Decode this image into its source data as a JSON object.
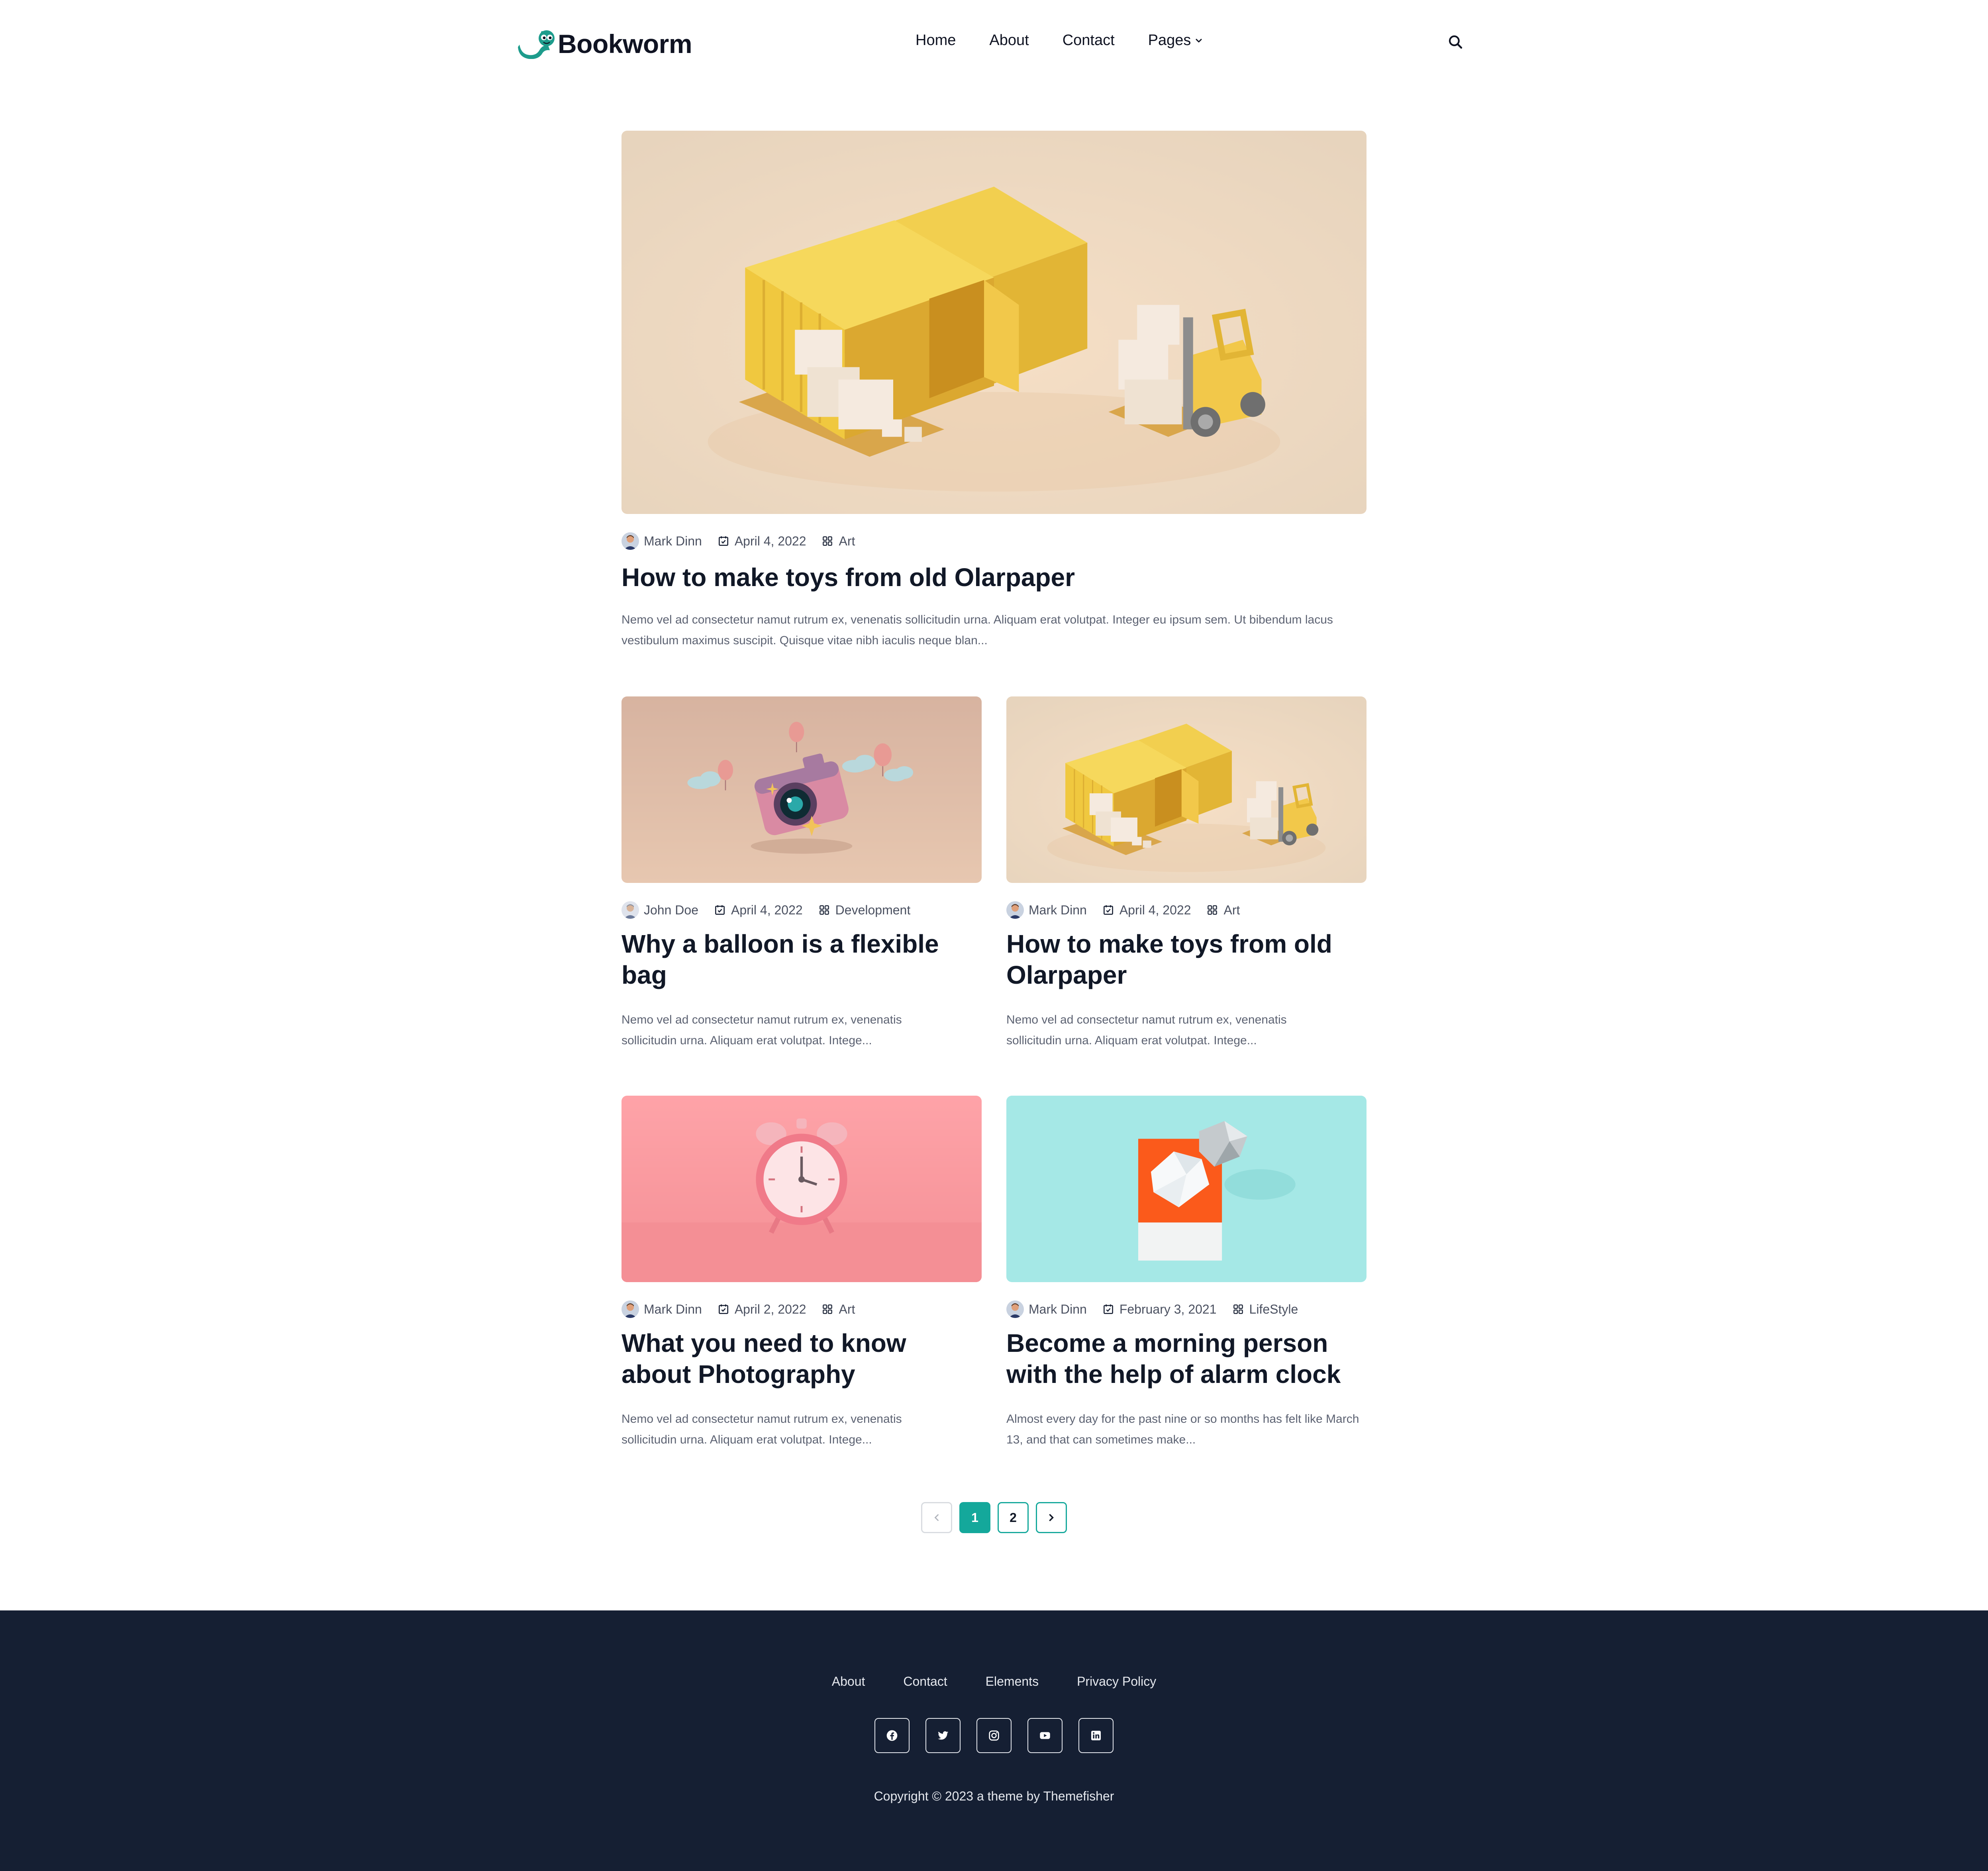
{
  "header": {
    "brand": "Bookworm",
    "nav": [
      {
        "label": "Home"
      },
      {
        "label": "About"
      },
      {
        "label": "Contact"
      },
      {
        "label": "Pages"
      }
    ],
    "accent_color": "#14a89b"
  },
  "posts": [
    {
      "author": "Mark Dinn",
      "date": "April 4, 2022",
      "category": "Art",
      "title": "How to make toys from old Olarpaper",
      "excerpt": "Nemo vel ad consectetur namut rutrum ex, venenatis sollicitudin urna. Aliquam erat volutpat. Integer eu ipsum sem. Ut bibendum lacus vestibulum maximus suscipit. Quisque vitae nibh iaculis neque blan...",
      "image": "yellow-containers-forklift"
    },
    {
      "author": "John Doe",
      "date": "April 4, 2022",
      "category": "Development",
      "title": "Why a balloon is a flexible bag",
      "excerpt": "Nemo vel ad consectetur namut rutrum ex, venenatis sollicitudin urna. Aliquam erat volutpat. Intege...",
      "image": "pink-camera-balloons"
    },
    {
      "author": "Mark Dinn",
      "date": "April 4, 2022",
      "category": "Art",
      "title": "How to make toys from old Olarpaper",
      "excerpt": "Nemo vel ad consectetur namut rutrum ex, venenatis sollicitudin urna. Aliquam erat volutpat. Intege...",
      "image": "yellow-containers-forklift"
    },
    {
      "author": "Mark Dinn",
      "date": "April 2, 2022",
      "category": "Art",
      "title": "What you need to know about Photography",
      "excerpt": "Nemo vel ad consectetur namut rutrum ex, venenatis sollicitudin urna. Aliquam erat volutpat. Intege...",
      "image": "pink-alarm-clock"
    },
    {
      "author": "Mark Dinn",
      "date": "February 3, 2021",
      "category": "LifeStyle",
      "title": "Become a morning person with the help of alarm clock",
      "excerpt": "Almost every day for the past nine or so months has felt like March 13, and that can sometimes make...",
      "image": "paper-diamond"
    }
  ],
  "pagination": {
    "pages": [
      "1",
      "2"
    ],
    "current": "1"
  },
  "footer": {
    "links": [
      {
        "label": "About"
      },
      {
        "label": "Contact"
      },
      {
        "label": "Elements"
      },
      {
        "label": "Privacy Policy"
      }
    ],
    "socials": [
      "facebook-icon",
      "twitter-icon",
      "instagram-icon",
      "youtube-icon",
      "linkedin-icon"
    ],
    "copyright": "Copyright © 2023 a theme by Themefisher",
    "background": "#151f33"
  }
}
